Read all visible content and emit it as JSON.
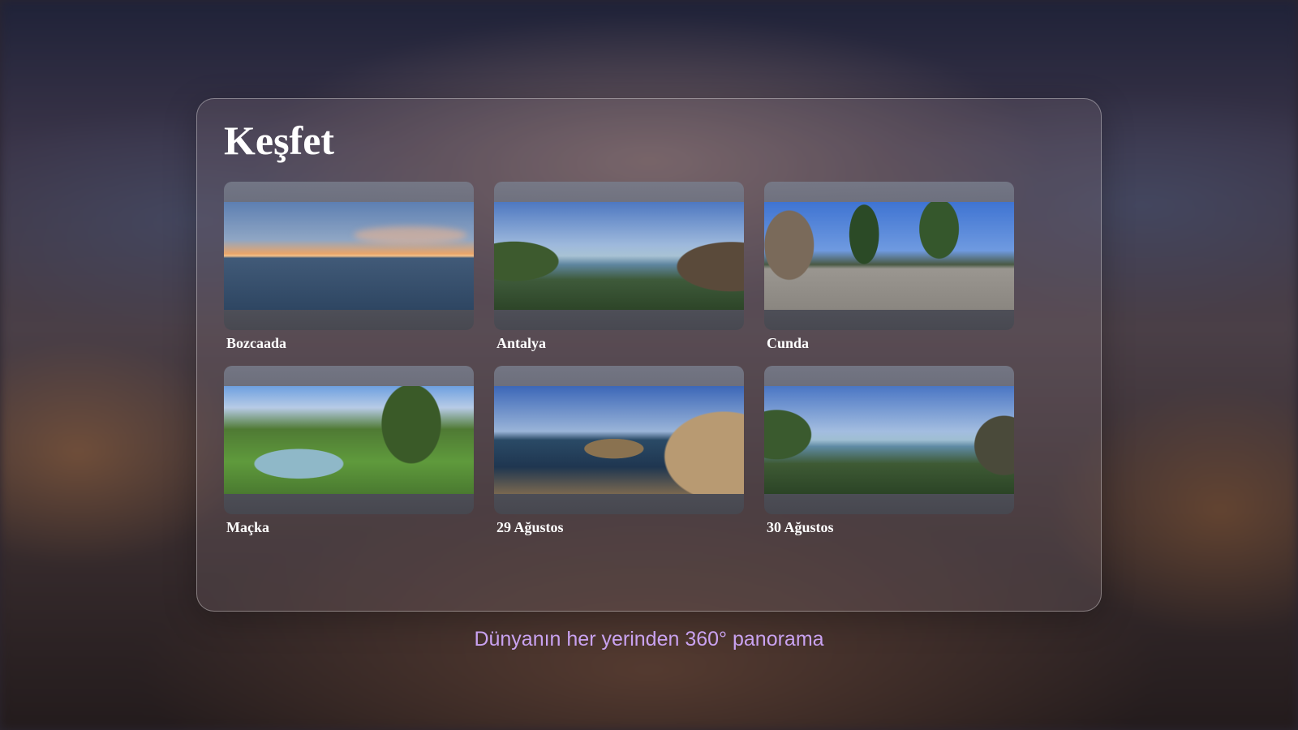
{
  "page": {
    "title": "Keşfet",
    "tagline": "Dünyanın her yerinden 360° panorama",
    "tagline_color": "#c9a2f0"
  },
  "gallery": {
    "items": [
      {
        "label": "Bozcaada",
        "scene": "sea-sunset"
      },
      {
        "label": "Antalya",
        "scene": "bay-islands"
      },
      {
        "label": "Cunda",
        "scene": "town-square"
      },
      {
        "label": "Maçka",
        "scene": "park-pool"
      },
      {
        "label": "29 Ağustos",
        "scene": "rocky-cliff"
      },
      {
        "label": "30 Ağustos",
        "scene": "bay-islands"
      }
    ]
  }
}
